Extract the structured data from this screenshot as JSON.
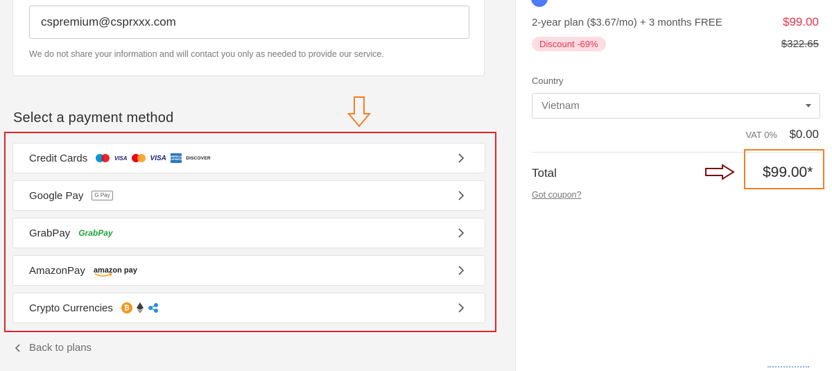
{
  "contact": {
    "email_value": "cspremium@csprxxx.com",
    "privacy_note": "We do not share your information and will contact you only as needed to provide our service."
  },
  "payment": {
    "section_title": "Select a payment method",
    "methods": [
      {
        "label": "Credit Cards"
      },
      {
        "label": "Google Pay",
        "logo_text": "G Pay"
      },
      {
        "label": "GrabPay",
        "logo_text": "GrabPay"
      },
      {
        "label": "AmazonPay",
        "logo_text": "amazon pay"
      },
      {
        "label": "Crypto Currencies"
      }
    ],
    "card_logos": {
      "visa_small": "VISA",
      "visa_large": "VISA",
      "amex": "AMERICAN EXPRESS",
      "discover": "DISCOVER"
    },
    "crypto_symbols": {
      "bitcoin": "₿",
      "ethereum": "◆"
    }
  },
  "navigation": {
    "back_label": "Back to plans"
  },
  "order_summary": {
    "plan_description": "2-year plan ($3.67/mo) + 3 months FREE",
    "plan_price": "$99.00",
    "discount_badge": "Discount -69%",
    "original_price": "$322.65",
    "country_label": "Country",
    "country_value": "Vietnam",
    "vat_label": "VAT 0%",
    "vat_amount": "$0.00",
    "total_label": "Total",
    "total_amount": "$99.00*",
    "coupon_link": "Got coupon?"
  },
  "colors": {
    "price_red": "#e8344a",
    "highlight_red": "#e0232b",
    "annotation_orange": "#f08024",
    "annotation_maroon": "#7a1010",
    "accent_blue": "#4d7cf5"
  },
  "icons": {
    "chevron": "chevron-right-icon",
    "back": "chevron-left-icon",
    "select": "caret-down-icon"
  }
}
